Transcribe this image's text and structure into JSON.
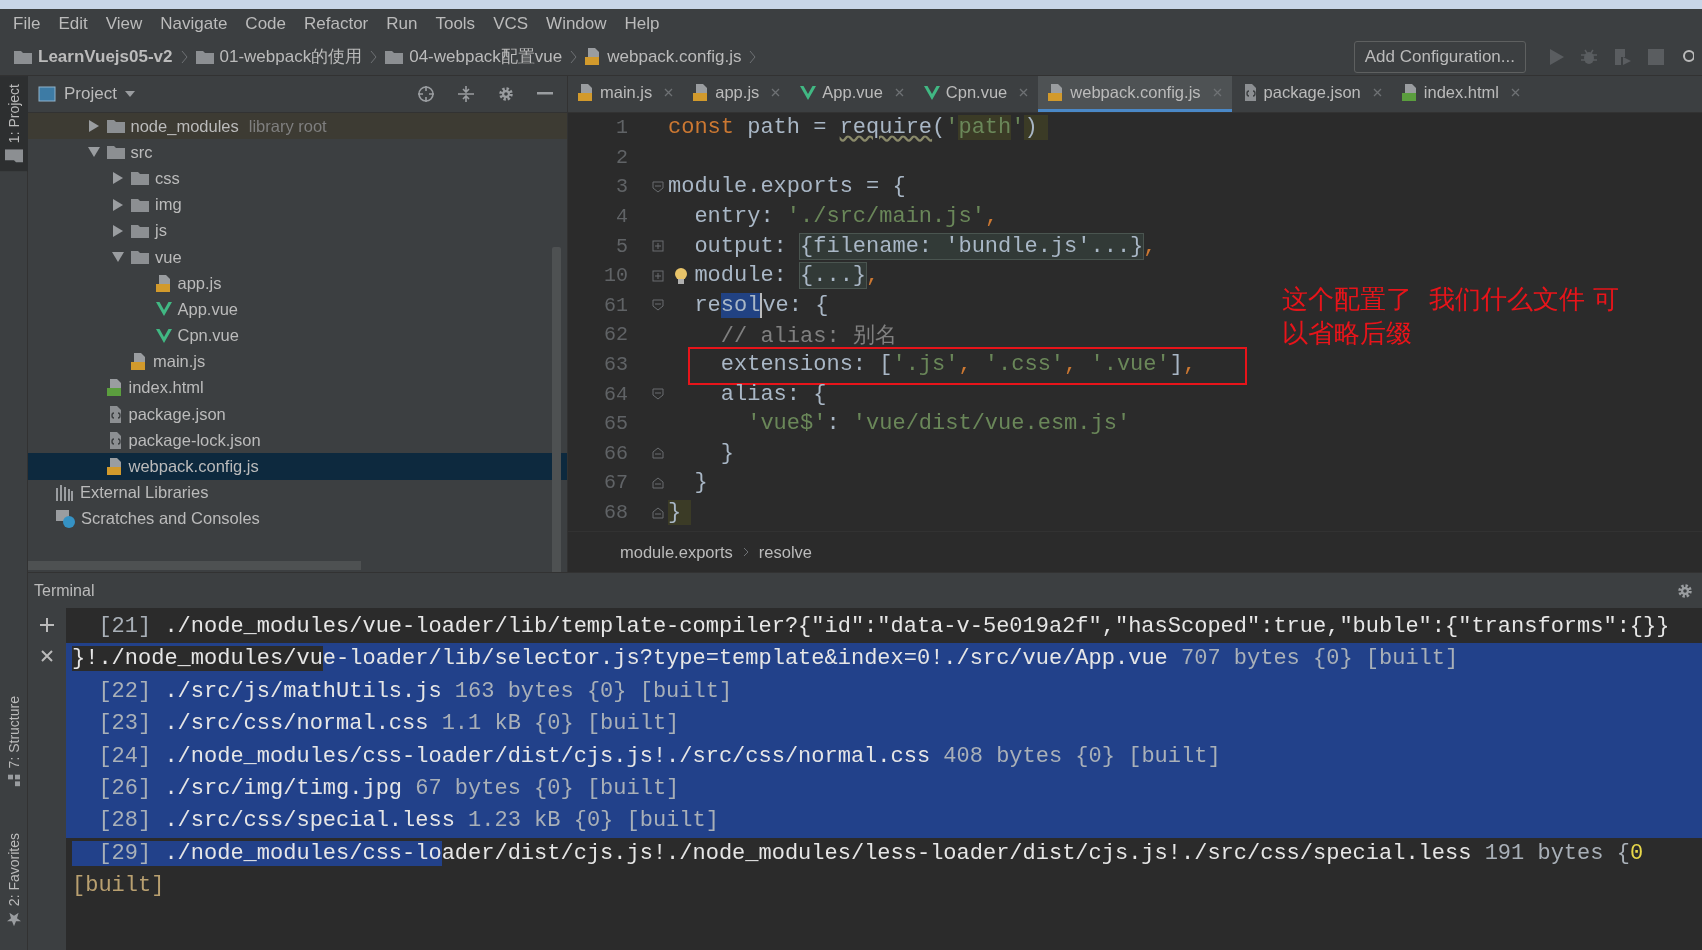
{
  "menu": [
    "File",
    "Edit",
    "View",
    "Navigate",
    "Code",
    "Refactor",
    "Run",
    "Tools",
    "VCS",
    "Window",
    "Help"
  ],
  "navigation_bar": {
    "crumbs": [
      {
        "label": "LearnVuejs05-v2",
        "kind": "folder"
      },
      {
        "label": "01-webpack的使用",
        "kind": "folder"
      },
      {
        "label": "04-webpack配置vue",
        "kind": "folder"
      },
      {
        "label": "webpack.config.js",
        "kind": "js"
      }
    ],
    "run_configuration": "Add Configuration..."
  },
  "tool_strip": [
    {
      "label": "1: Project",
      "kind": "folder",
      "selected": true
    },
    {
      "label": "7: Structure",
      "kind": "structure",
      "selected": false
    },
    {
      "label": "2: Favorites",
      "kind": "star",
      "selected": false
    }
  ],
  "project_panel": {
    "title": "Project",
    "tree": [
      {
        "label": "node_modules",
        "hint": "library root",
        "kind": "folder",
        "expanded": false,
        "selected": false
      },
      {
        "label": "src",
        "kind": "folder",
        "expanded": true,
        "selected": false,
        "children": [
          {
            "label": "css",
            "kind": "folder",
            "expanded": false,
            "selected": false
          },
          {
            "label": "img",
            "kind": "folder",
            "expanded": false,
            "selected": false
          },
          {
            "label": "js",
            "kind": "folder",
            "expanded": false,
            "selected": false
          },
          {
            "label": "vue",
            "kind": "folder",
            "expanded": true,
            "selected": false,
            "children": [
              {
                "label": "app.js",
                "kind": "js",
                "selected": false
              },
              {
                "label": "App.vue",
                "kind": "vue",
                "selected": false
              },
              {
                "label": "Cpn.vue",
                "kind": "vue",
                "selected": false
              }
            ]
          },
          {
            "label": "main.js",
            "kind": "js",
            "selected": false
          }
        ]
      },
      {
        "label": "index.html",
        "kind": "html",
        "selected": false
      },
      {
        "label": "package.json",
        "kind": "json",
        "selected": false
      },
      {
        "label": "package-lock.json",
        "kind": "json",
        "selected": false
      },
      {
        "label": "webpack.config.js",
        "kind": "js",
        "selected": true
      }
    ],
    "extra": [
      {
        "label": "External Libraries",
        "kind": "libraries",
        "selected": false
      },
      {
        "label": "Scratches and Consoles",
        "kind": "scratches",
        "selected": false
      }
    ]
  },
  "editor": {
    "tabs": [
      {
        "label": "main.js",
        "kind": "js",
        "selected": false
      },
      {
        "label": "app.js",
        "kind": "js",
        "selected": false
      },
      {
        "label": "App.vue",
        "kind": "vue",
        "selected": false
      },
      {
        "label": "Cpn.vue",
        "kind": "vue",
        "selected": false
      },
      {
        "label": "webpack.config.js",
        "kind": "js",
        "selected": true
      },
      {
        "label": "package.json",
        "kind": "json",
        "selected": false
      },
      {
        "label": "index.html",
        "kind": "html",
        "selected": false
      }
    ],
    "lines": [
      {
        "number": "1",
        "kind": "plain",
        "tokens": [
          {
            "text": "const",
            "kind": "keyword"
          },
          {
            "text": " path = ",
            "kind": "plain"
          },
          {
            "text": "require",
            "kind": "warn"
          },
          {
            "text": "(",
            "kind": "plain"
          },
          {
            "text": "'",
            "kind": "string"
          },
          {
            "text": "path",
            "kind": "string-hl"
          },
          {
            "text": "'",
            "kind": "string"
          },
          {
            "text": ")",
            "kind": "brace-match"
          }
        ]
      },
      {
        "number": "2",
        "kind": "plain"
      },
      {
        "number": "3",
        "kind": "fold-open",
        "tokens": [
          {
            "text": "module.exports = {",
            "kind": "plain"
          }
        ]
      },
      {
        "number": "4",
        "kind": "plain",
        "tokens": [
          {
            "text": "  entry: ",
            "kind": "plain"
          },
          {
            "text": "'./src/main.js'",
            "kind": "string"
          },
          {
            "text": ",",
            "kind": "punct"
          }
        ]
      },
      {
        "number": "5",
        "kind": "fold-closed",
        "tokens": [
          {
            "text": "  output: ",
            "kind": "plain"
          },
          {
            "text": "{filename: 'bundle.js'...}",
            "kind": "folded"
          },
          {
            "text": ",",
            "kind": "punct"
          }
        ]
      },
      {
        "number": "10",
        "kind": "fold-closed",
        "bulb": true,
        "tokens": [
          {
            "text": "  module: ",
            "kind": "plain"
          },
          {
            "text": "{...}",
            "kind": "folded"
          },
          {
            "text": ",",
            "kind": "punct"
          }
        ]
      },
      {
        "number": "61",
        "kind": "fold-open",
        "tokens": [
          {
            "text": "  re",
            "kind": "plain"
          },
          {
            "text": "sol",
            "kind": "selection"
          },
          {
            "text": "ve",
            "kind": "caret-before"
          },
          {
            "text": ": {",
            "kind": "plain"
          }
        ]
      },
      {
        "number": "62",
        "kind": "plain",
        "tokens": [
          {
            "text": "    // alias: 别名",
            "kind": "comment"
          }
        ]
      },
      {
        "number": "63",
        "kind": "plain",
        "boxed": true,
        "tokens": [
          {
            "text": "    extensions: [",
            "kind": "plain"
          },
          {
            "text": "'.js'",
            "kind": "string"
          },
          {
            "text": ", ",
            "kind": "punct"
          },
          {
            "text": "'.css'",
            "kind": "string"
          },
          {
            "text": ", ",
            "kind": "punct"
          },
          {
            "text": "'.vue'",
            "kind": "string"
          },
          {
            "text": "]",
            "kind": "plain"
          },
          {
            "text": ",",
            "kind": "punct"
          }
        ]
      },
      {
        "number": "64",
        "kind": "fold-open",
        "tokens": [
          {
            "text": "    alias: {",
            "kind": "plain"
          }
        ]
      },
      {
        "number": "65",
        "kind": "plain",
        "tokens": [
          {
            "text": "      'vue$'",
            "kind": "string"
          },
          {
            "text": ": ",
            "kind": "plain"
          },
          {
            "text": "'vue/dist/vue.esm.js'",
            "kind": "string"
          }
        ]
      },
      {
        "number": "66",
        "kind": "fold-end",
        "tokens": [
          {
            "text": "    }",
            "kind": "plain"
          }
        ]
      },
      {
        "number": "67",
        "kind": "fold-end",
        "tokens": [
          {
            "text": "  }",
            "kind": "plain"
          }
        ]
      },
      {
        "number": "68",
        "kind": "fold-end",
        "tokens": [
          {
            "text": "}",
            "kind": "brace-match"
          }
        ]
      }
    ],
    "annotation": "这个配置了  我们什么文件 可以省略后缀",
    "breadcrumbs": [
      "module.exports",
      "resolve"
    ]
  },
  "terminal": {
    "title": "Terminal",
    "lines": [
      {
        "kind": "entry",
        "selected": false,
        "segments": [
          {
            "text": "[21]",
            "kind": "meta",
            "selected": false
          },
          {
            "text": " ./node_modules/vue-loader/lib/template-compiler?{\"id\":\"data-v-5e019a2f\",\"hasScoped\":true,\"buble\":{\"transforms\":{}}",
            "kind": "path",
            "selected": false
          }
        ]
      },
      {
        "kind": "continuation",
        "selected": true,
        "segments": [
          {
            "text": "}!./node_modules/vu",
            "kind": "path",
            "selected": false
          },
          {
            "text": "e-loader/lib/selector.js?type=template&index=0!./src/vue/App.vue",
            "kind": "path",
            "selected": true
          },
          {
            "text": " 707 bytes {0} [built]",
            "kind": "meta",
            "selected": true
          }
        ]
      },
      {
        "kind": "entry",
        "selected": true,
        "segments": [
          {
            "text": "[22]",
            "kind": "meta",
            "selected": true
          },
          {
            "text": " ./src/js/mathUtils.js",
            "kind": "path",
            "selected": true
          },
          {
            "text": " 163 bytes {0} [built]",
            "kind": "meta",
            "selected": true
          }
        ]
      },
      {
        "kind": "entry",
        "selected": true,
        "segments": [
          {
            "text": "[23]",
            "kind": "meta",
            "selected": true
          },
          {
            "text": " ./src/css/normal.css",
            "kind": "path",
            "selected": true
          },
          {
            "text": " 1.1 kB {0} [built]",
            "kind": "meta",
            "selected": true
          }
        ]
      },
      {
        "kind": "entry",
        "selected": true,
        "segments": [
          {
            "text": "[24]",
            "kind": "meta",
            "selected": true
          },
          {
            "text": " ./node_modules/css-loader/dist/cjs.js!./src/css/normal.css",
            "kind": "path",
            "selected": true
          },
          {
            "text": " 408 bytes {0} [built]",
            "kind": "meta",
            "selected": true
          }
        ]
      },
      {
        "kind": "entry",
        "selected": true,
        "segments": [
          {
            "text": "[26]",
            "kind": "meta",
            "selected": true
          },
          {
            "text": " ./src/img/timg.jpg",
            "kind": "path",
            "selected": true
          },
          {
            "text": " 67 bytes {0} [built]",
            "kind": "meta",
            "selected": true
          }
        ]
      },
      {
        "kind": "entry",
        "selected": true,
        "segments": [
          {
            "text": "[28]",
            "kind": "meta",
            "selected": true
          },
          {
            "text": " ./src/css/special.less",
            "kind": "path",
            "selected": true
          },
          {
            "text": " 1.23 kB {0} [built]",
            "kind": "meta",
            "selected": true
          }
        ]
      },
      {
        "kind": "entry",
        "selected": false,
        "segments": [
          {
            "text": "[29]",
            "kind": "meta",
            "selected": true
          },
          {
            "text": " ./node_modules/css-lo",
            "kind": "path",
            "selected": true
          },
          {
            "text": "ader/dist/cjs.js!./node_modules/less-loader/dist/cjs.js!./src/css/special.less",
            "kind": "path",
            "selected": false
          },
          {
            "text": " 191 bytes {",
            "kind": "meta",
            "selected": false
          },
          {
            "text": "0",
            "kind": "number",
            "selected": false
          }
        ]
      },
      {
        "kind": "continuation",
        "selected": false,
        "segments": [
          {
            "text": "[built]",
            "kind": "built",
            "selected": false
          }
        ]
      }
    ]
  }
}
